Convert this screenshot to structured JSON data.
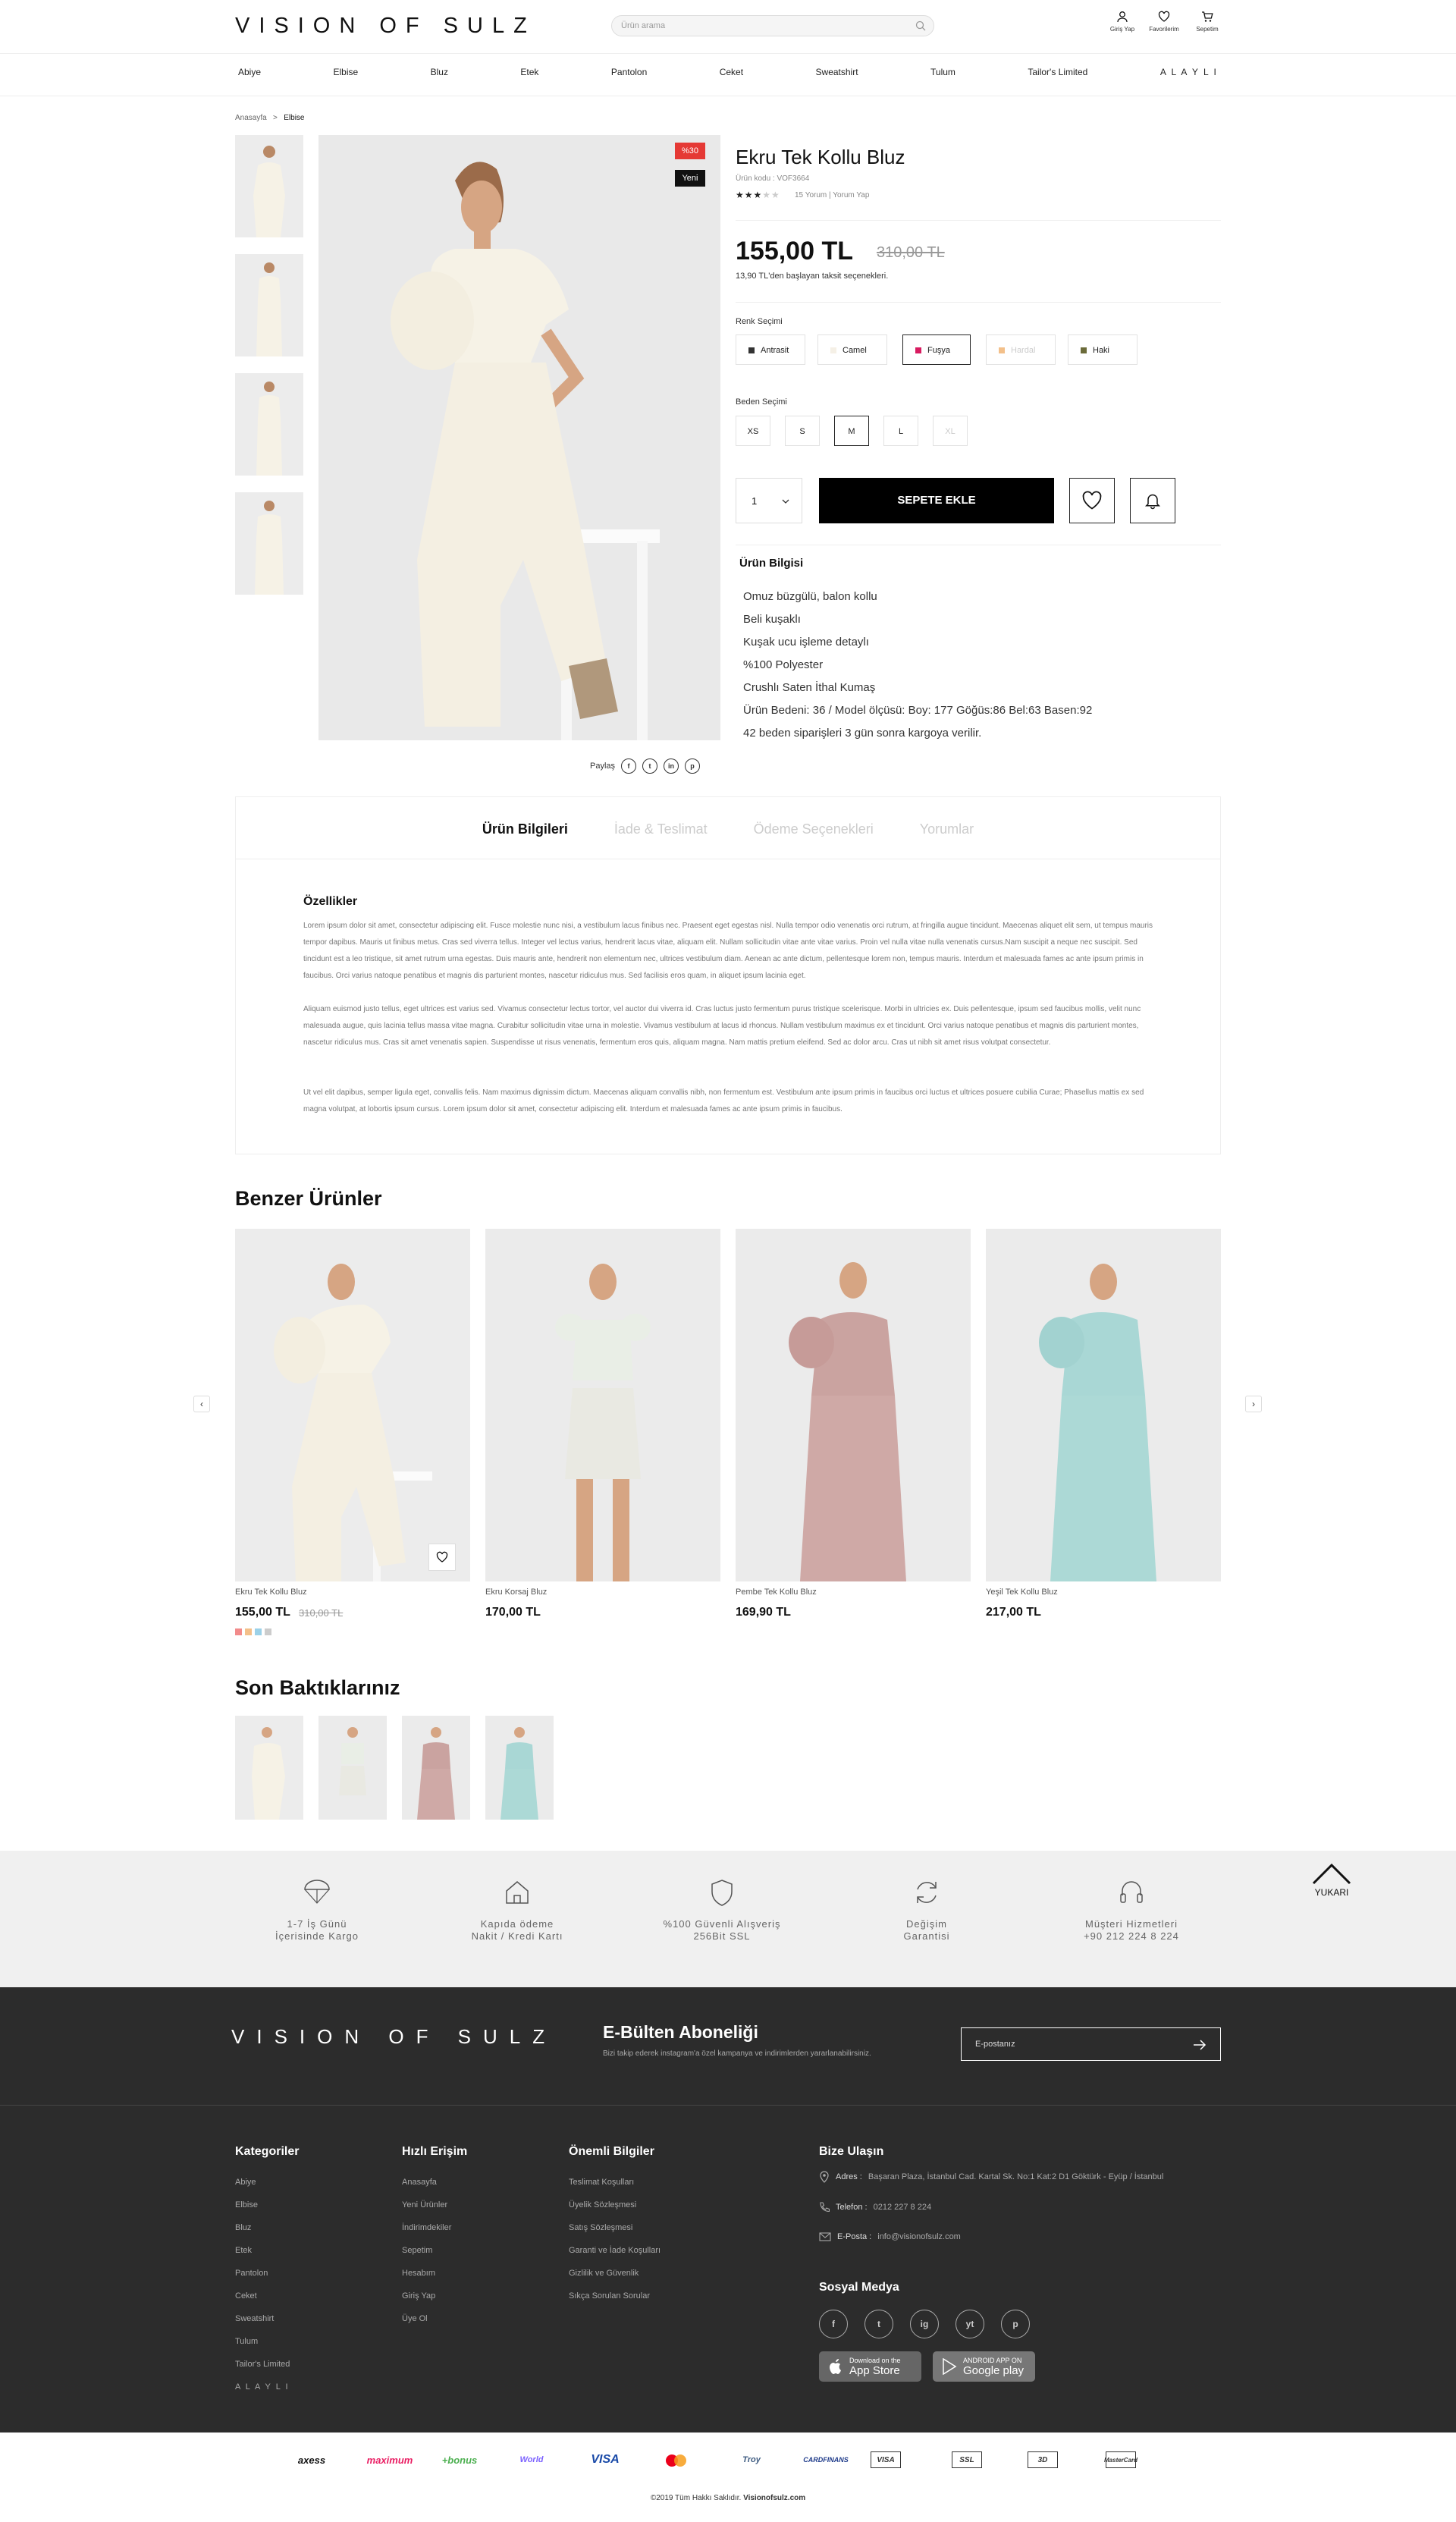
{
  "header": {
    "logo": "VISION OF SULZ",
    "search_placeholder": "Ürün arama",
    "icons": [
      {
        "label": "Giriş Yap",
        "icon": "user-icon"
      },
      {
        "label": "Favorilerim",
        "icon": "heart-icon"
      },
      {
        "label": "Sepetim",
        "icon": "cart-icon"
      }
    ],
    "nav": [
      "Abiye",
      "Elbise",
      "Bluz",
      "Etek",
      "Pantolon",
      "Ceket",
      "Sweatshirt",
      "Tulum",
      "Tailor's Limited",
      "A L A Y L I"
    ]
  },
  "breadcrumb": {
    "home": "Anasayfa",
    "sep": ">",
    "current": "Elbise"
  },
  "product": {
    "badge_discount": "%30",
    "badge_new": "Yeni",
    "title": "Ekru Tek Kollu Bluz",
    "code": "Ürün kodu : VOF3664",
    "stars_on": "★★★",
    "stars_off": "★★",
    "rating": 3,
    "reviews": "15 Yorum | Yorum Yap",
    "price": "155,00 TL",
    "old_price": "310,00 TL",
    "installment": "13,90 TL'den başlayan taksit seçenekleri.",
    "color_label": "Renk Seçimi",
    "colors": [
      {
        "name": "Antrasit",
        "hex": "#333333"
      },
      {
        "name": "Camel",
        "hex": "#f5f0e6"
      },
      {
        "name": "Fuşya",
        "hex": "#d81b60"
      },
      {
        "name": "Hardal",
        "hex": "#f3c08a"
      },
      {
        "name": "Haki",
        "hex": "#6b6b3a"
      }
    ],
    "selected_color": "Fuşya",
    "size_label": "Beden Seçimi",
    "sizes": [
      "XS",
      "S",
      "M",
      "L",
      "XL"
    ],
    "selected_size": "M",
    "quantity": "1",
    "add_to_cart": "SEPETE EKLE",
    "info_title": "Ürün Bilgisi",
    "info": [
      "Omuz büzgülü, balon kollu",
      "Beli kuşaklı",
      "Kuşak ucu işleme detaylı",
      "%100 Polyester",
      "Crushlı Saten  İthal Kumaş",
      "Ürün Bedeni: 36 / Model ölçüsü: Boy: 177 Göğüs:86  Bel:63  Basen:92",
      "42 beden siparişleri 3 gün sonra kargoya verilir."
    ],
    "share_label": "Paylaş",
    "share_icons": [
      "f",
      "t",
      "in",
      "p"
    ]
  },
  "tabs": {
    "items": [
      "Ürün Bilgileri",
      "İade & Teslimat",
      "Ödeme Seçenekleri",
      "Yorumlar"
    ],
    "active": 0,
    "features_title": "Özellikler",
    "paragraphs": [
      "Lorem ipsum dolor sit amet, consectetur adipiscing elit. Fusce molestie nunc nisi, a vestibulum lacus finibus nec. Praesent eget egestas nisl. Nulla tempor odio venenatis orci rutrum, at fringilla augue tincidunt. Maecenas aliquet elit sem, ut tempus mauris tempor dapibus. Mauris ut finibus metus. Cras sed viverra tellus. Integer vel lectus varius, hendrerit lacus vitae, aliquam elit. Nullam sollicitudin vitae ante vitae varius. Proin vel nulla vitae nulla venenatis cursus.Nam suscipit a neque nec suscipit. Sed tincidunt est a leo tristique, sit amet rutrum urna egestas. Duis mauris ante, hendrerit non elementum nec, ultrices vestibulum diam. Aenean ac ante dictum, pellentesque lorem non, tempus mauris. Interdum et malesuada fames ac ante ipsum primis in faucibus. Orci varius natoque penatibus et magnis dis parturient montes, nascetur ridiculus mus. Sed facilisis eros quam, in aliquet ipsum lacinia eget.",
      "Aliquam euismod justo tellus, eget ultrices est varius sed. Vivamus consectetur lectus tortor, vel auctor dui viverra id. Cras luctus justo fermentum purus tristique scelerisque. Morbi in ultricies ex. Duis pellentesque, ipsum sed faucibus mollis, velit nunc malesuada augue, quis lacinia tellus massa vitae magna. Curabitur sollicitudin vitae urna in molestie. Vivamus vestibulum at lacus id rhoncus. Nullam vestibulum maximus ex et tincidunt. Orci varius natoque penatibus et magnis dis parturient montes, nascetur ridiculus mus. Cras sit amet venenatis sapien. Suspendisse ut risus venenatis, fermentum eros quis, aliquam magna. Nam mattis pretium eleifend. Sed ac dolor arcu. Cras ut nibh sit amet risus volutpat consectetur.",
      "Ut vel elit dapibus, semper ligula eget, convallis felis. Nam maximus dignissim dictum. Maecenas aliquam convallis nibh, non fermentum est. Vestibulum ante ipsum primis in faucibus orci luctus et ultrices posuere cubilia Curae; Phasellus mattis ex sed magna volutpat, at lobortis ipsum cursus. Lorem ipsum dolor sit amet, consectetur adipiscing elit. Interdum et malesuada fames ac ante ipsum primis in faucibus."
    ]
  },
  "similar": {
    "title": "Benzer Ürünler",
    "items": [
      {
        "name": "Ekru Tek Kollu Bluz",
        "price": "155,00 TL",
        "old_price": "310,00 TL",
        "swatches": [
          "#f28b8b",
          "#f3c08a",
          "#9bd1e8",
          "#cccccc"
        ],
        "dress": "#f6f2e6"
      },
      {
        "name": "Ekru Korsaj Bluz",
        "price": "170,00 TL",
        "dress": "#e9eee6"
      },
      {
        "name": "Pembe Tek Kollu Bluz",
        "price": "169,90 TL",
        "dress": "#caa3a0"
      },
      {
        "name": "Yeşil Tek Kollu Bluz",
        "price": "217,00 TL",
        "dress": "#a9d7d5"
      }
    ]
  },
  "recent": {
    "title": "Son Baktıklarınız",
    "dresses": [
      "#f6f2e6",
      "#e9eee6",
      "#caa3a0",
      "#a9d7d5"
    ]
  },
  "features": [
    {
      "line1": "1-7 İş Günü",
      "line2": "İçerisinde Kargo",
      "icon": "parachute-icon"
    },
    {
      "line1": "Kapıda ödeme",
      "line2": "Nakit / Kredi Kartı",
      "icon": "home-icon"
    },
    {
      "line1": "%100 Güvenli Alışveriş",
      "line2": "256Bit SSL",
      "icon": "shield-icon"
    },
    {
      "line1": "Değişim",
      "line2": "Garantisi",
      "icon": "refresh-icon"
    },
    {
      "line1": "Müşteri Hizmetleri",
      "line2": "+90 212 224 8 224",
      "icon": "headset-icon"
    }
  ],
  "scroll_top": "YUKARI",
  "footer": {
    "logo": "VISION OF SULZ",
    "newsletter_title": "E-Bülten Aboneliği",
    "newsletter_sub": "Bizi takip ederek instagram'a özel kampanya ve indirimlerden yararlanabilirsiniz.",
    "newsletter_placeholder": "E-postanız",
    "columns": [
      {
        "title": "Kategoriler",
        "items": [
          "Abiye",
          "Elbise",
          "Bluz",
          "Etek",
          "Pantolon",
          "Ceket",
          "Sweatshirt",
          "Tulum",
          "Tailor's Limited",
          "A L A Y L I"
        ]
      },
      {
        "title": "Hızlı Erişim",
        "items": [
          "Anasayfa",
          "Yeni Ürünler",
          "İndirimdekiler",
          "Sepetim",
          "Hesabım",
          "Giriş Yap",
          "Üye Ol"
        ]
      },
      {
        "title": "Önemli Bilgiler",
        "items": [
          "Teslimat Koşulları",
          "Üyelik Sözleşmesi",
          "Satış Sözleşmesi",
          "Garanti ve İade Koşulları",
          "Gizlilik ve Güvenlik",
          "Sıkça Sorulan Sorular"
        ]
      }
    ],
    "contact_title": "Bize Ulaşın",
    "address_label": "Adres :",
    "address": "Başaran Plaza, İstanbul Cad. Kartal Sk. No:1 Kat:2 D1 Göktürk - Eyüp / İstanbul",
    "phone_label": "Telefon :",
    "phone": "0212 227 8 224",
    "email_label": "E-Posta :",
    "email": "info@visionofsulz.com",
    "social_title": "Sosyal Medya",
    "social": [
      "f",
      "t",
      "ig",
      "yt",
      "p"
    ],
    "appstore_small": "Download on the",
    "appstore": "App Store",
    "gplay_small": "ANDROID APP ON",
    "gplay": "Google play"
  },
  "payments": [
    "axess",
    "maximum",
    "+bonus",
    "World",
    "VISA",
    "mastercard",
    "Troy",
    "CARDFINANS",
    "VISA",
    "SSL",
    "3D",
    "MasterCard"
  ],
  "copyright": "©2019 Tüm Hakkı Saklıdır.",
  "copyright_site": "Visionofsulz.com"
}
